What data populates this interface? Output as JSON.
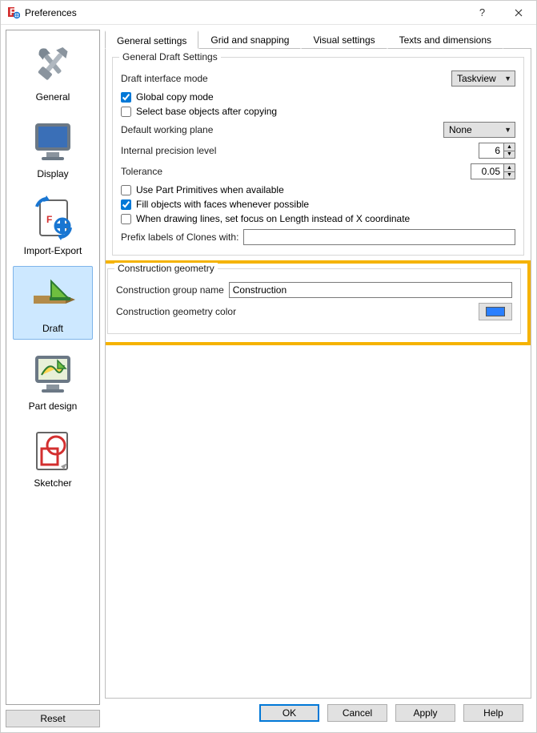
{
  "window": {
    "title": "Preferences"
  },
  "sidebar": {
    "items": [
      {
        "label": "General"
      },
      {
        "label": "Display"
      },
      {
        "label": "Import-Export"
      },
      {
        "label": "Draft"
      },
      {
        "label": "Part design"
      },
      {
        "label": "Sketcher"
      }
    ],
    "reset": "Reset"
  },
  "tabs": [
    {
      "label": "General settings"
    },
    {
      "label": "Grid and snapping"
    },
    {
      "label": "Visual settings"
    },
    {
      "label": "Texts and dimensions"
    }
  ],
  "general_draft": {
    "title": "General Draft Settings",
    "interface_mode_label": "Draft interface mode",
    "interface_mode_value": "Taskview",
    "global_copy": "Global copy mode",
    "select_base": "Select base objects after copying",
    "working_plane_label": "Default working plane",
    "working_plane_value": "None",
    "precision_label": "Internal precision level",
    "precision_value": "6",
    "tolerance_label": "Tolerance",
    "tolerance_value": "0.05",
    "use_part_primitives": "Use Part Primitives when available",
    "fill_faces": "Fill objects with faces whenever possible",
    "focus_length": "When drawing lines, set focus on Length instead of X coordinate",
    "prefix_clones_label": "Prefix labels of Clones with:",
    "prefix_clones_value": ""
  },
  "construction": {
    "title": "Construction geometry",
    "group_name_label": "Construction group name",
    "group_name_value": "Construction",
    "color_label": "Construction geometry color",
    "color_value": "#2a7fff"
  },
  "footer": {
    "ok": "OK",
    "cancel": "Cancel",
    "apply": "Apply",
    "help": "Help"
  }
}
